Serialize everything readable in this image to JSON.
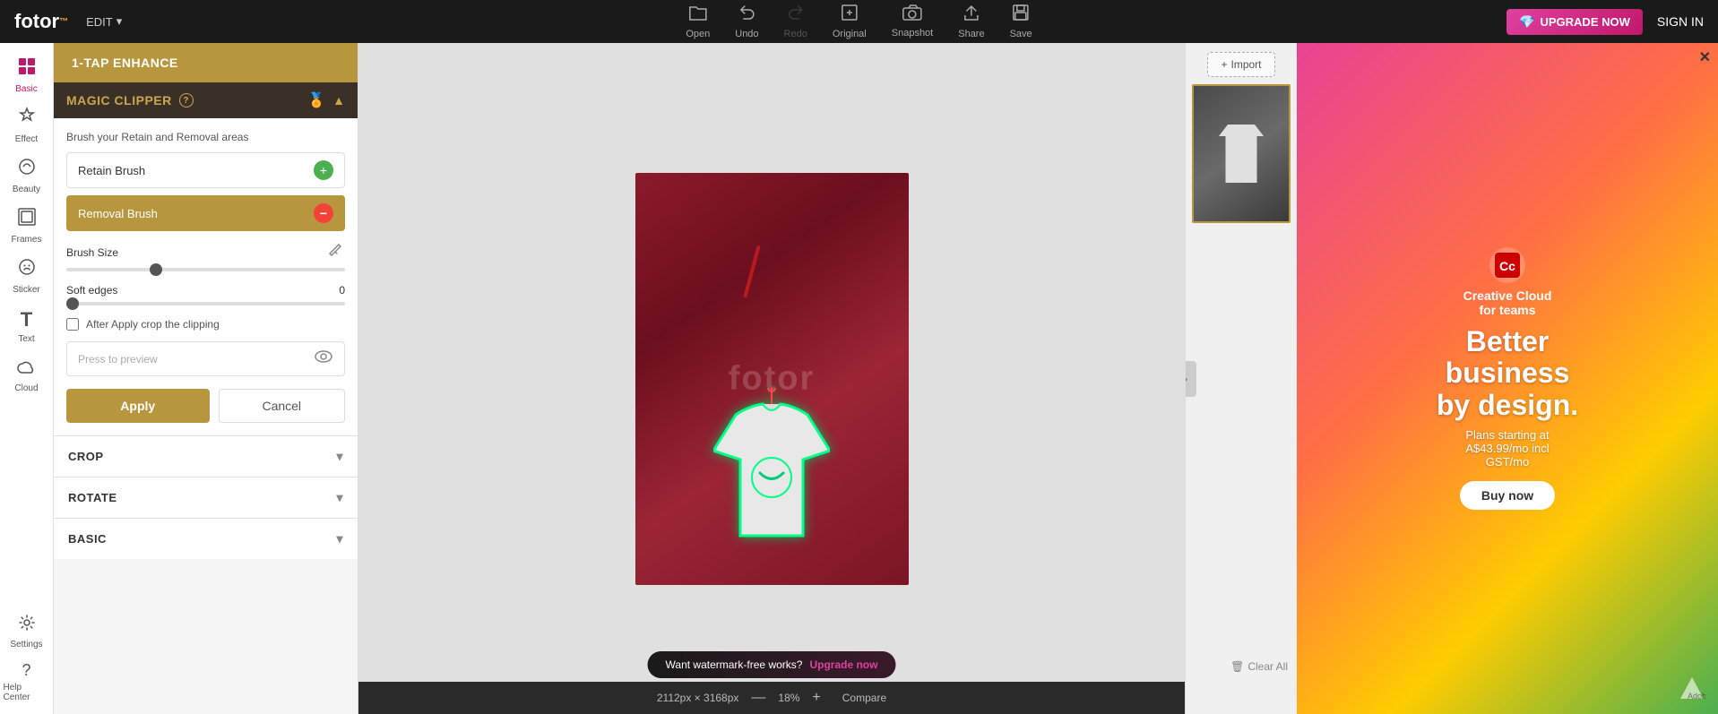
{
  "app": {
    "logo": "fotor",
    "logo_dot": "™",
    "edit_label": "EDIT"
  },
  "topbar": {
    "tools": [
      {
        "id": "open",
        "label": "Open",
        "icon": "📂"
      },
      {
        "id": "undo",
        "label": "Undo",
        "icon": "↩"
      },
      {
        "id": "redo",
        "label": "Redo",
        "icon": "↪",
        "disabled": true
      },
      {
        "id": "original",
        "label": "Original",
        "icon": "🖼"
      },
      {
        "id": "snapshot",
        "label": "Snapshot",
        "icon": "📷"
      },
      {
        "id": "share",
        "label": "Share",
        "icon": "⬆"
      },
      {
        "id": "save",
        "label": "Save",
        "icon": "💾"
      }
    ],
    "upgrade_label": "UPGRADE NOW",
    "signin_label": "SIGN IN"
  },
  "icon_sidebar": {
    "items": [
      {
        "id": "basic",
        "label": "Basic",
        "icon": "✦"
      },
      {
        "id": "effect",
        "label": "Effect",
        "icon": "★"
      },
      {
        "id": "beauty",
        "label": "Beauty",
        "icon": "◑"
      },
      {
        "id": "frames",
        "label": "Frames",
        "icon": "▣"
      },
      {
        "id": "sticker",
        "label": "Sticker",
        "icon": "◐"
      },
      {
        "id": "text",
        "label": "Text",
        "icon": "T"
      },
      {
        "id": "cloud",
        "label": "Cloud",
        "icon": "☁"
      }
    ],
    "bottom": [
      {
        "id": "settings",
        "label": "Settings",
        "icon": "⚙"
      },
      {
        "id": "help",
        "label": "Help Center",
        "icon": "?"
      }
    ]
  },
  "panel": {
    "one_tap_enhance": "1-TAP ENHANCE",
    "magic_clipper": {
      "title": "MAGIC CLIPPER",
      "help_label": "?",
      "brush_instruction": "Brush your Retain and Removal areas",
      "retain_brush_label": "Retain Brush",
      "removal_brush_label": "Removal Brush",
      "brush_size_label": "Brush Size",
      "soft_edges_label": "Soft edges",
      "soft_edges_value": "0",
      "checkbox_label": "After Apply crop the clipping",
      "preview_placeholder": "Press to preview",
      "apply_label": "Apply",
      "cancel_label": "Cancel"
    },
    "crop_label": "CROP",
    "rotate_label": "ROTATE",
    "basic_label": "BASIC"
  },
  "canvas": {
    "upgrade_bar_text": "Want watermark-free works?",
    "upgrade_bar_link": "Upgrade now",
    "zoom_info": "2112px × 3168px",
    "zoom_separator": "—",
    "zoom_percent": "18%",
    "zoom_plus": "+",
    "compare_label": "Compare"
  },
  "right_panel": {
    "import_label": "Import",
    "clear_all_label": "Clear All"
  },
  "ad": {
    "close_label": "✕",
    "cc_name": "Creative Cloud",
    "cc_tagline": "for teams",
    "headline_line1": "Better",
    "headline_line2": "business",
    "headline_line3": "by design.",
    "subtext": "Plans starting at\nA$43.99/mo incl\nGST/mo",
    "buy_label": "Buy now"
  }
}
